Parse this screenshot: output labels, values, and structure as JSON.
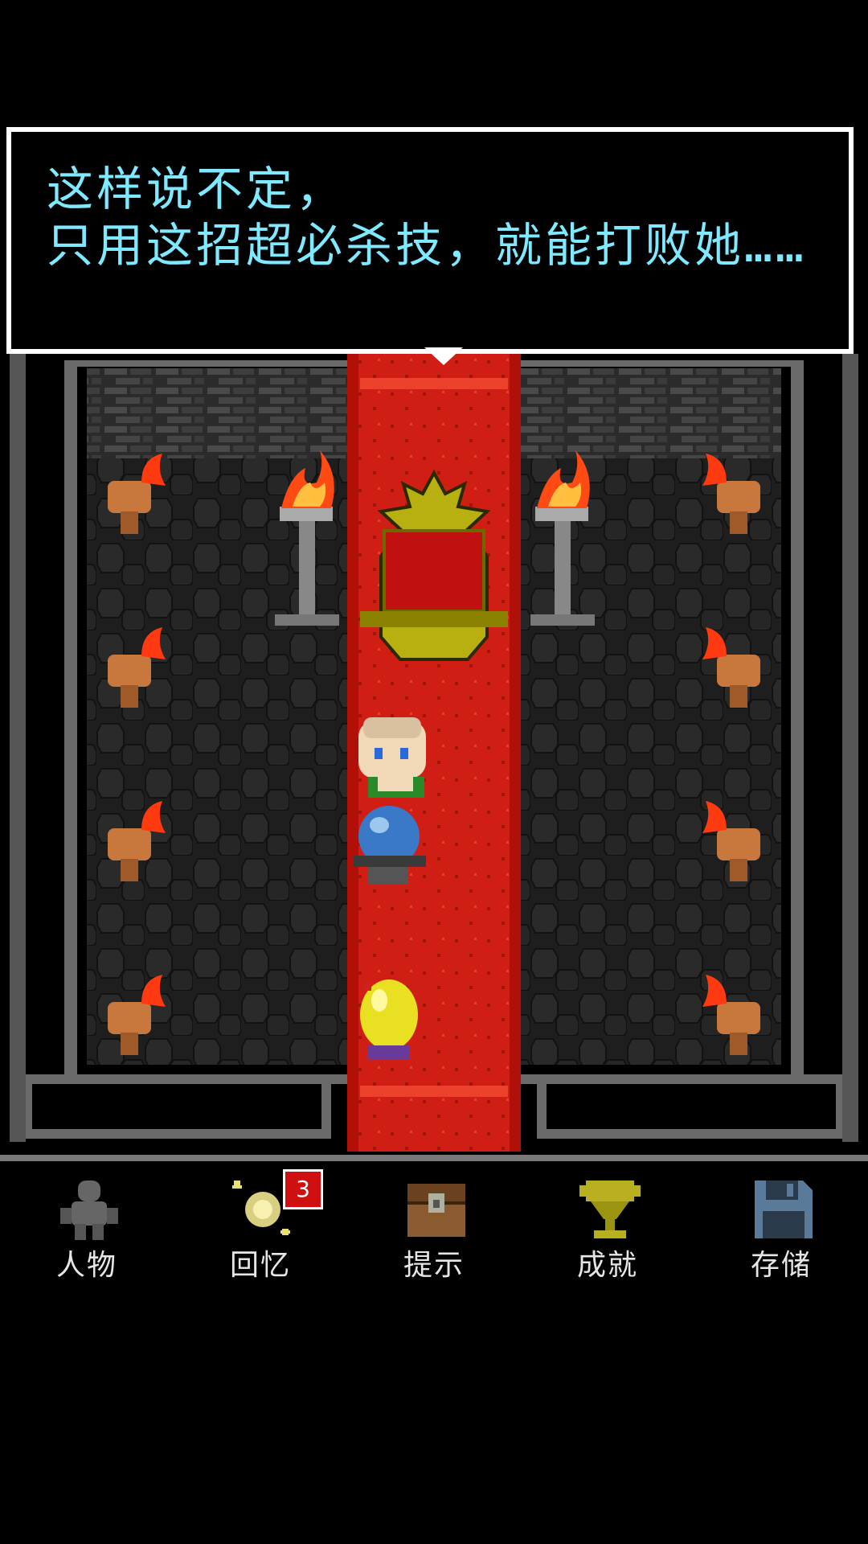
{
  "dialog": {
    "line1": "这样说不定，",
    "line2": "只用这招超必杀技，就能打败她……"
  },
  "menu": {
    "items": [
      {
        "label": "人物",
        "icon": "character-silhouette-icon"
      },
      {
        "label": "回忆",
        "icon": "memory-sparkle-icon",
        "badge": "3"
      },
      {
        "label": "提示",
        "icon": "treasure-chest-icon"
      },
      {
        "label": "成就",
        "icon": "trophy-icon"
      },
      {
        "label": "存储",
        "icon": "floppy-disk-icon"
      }
    ]
  },
  "colors": {
    "dialog_text": "#7fe9ff",
    "carpet": "#d01e14",
    "badge": "#d01010"
  }
}
